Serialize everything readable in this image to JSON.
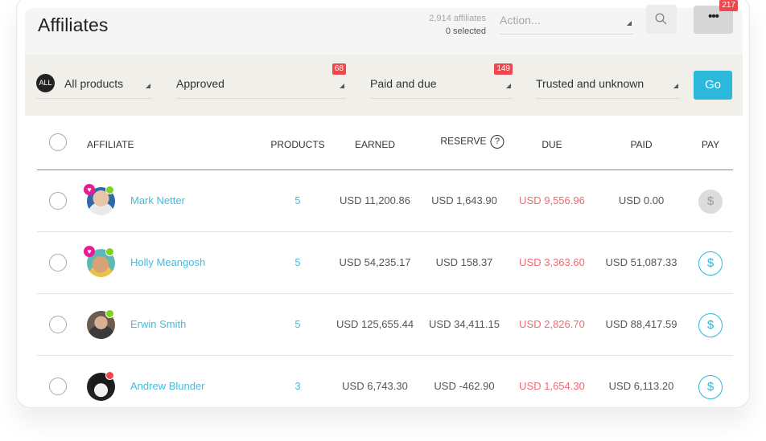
{
  "header": {
    "title": "Affiliates",
    "total_count": "2,914 affiliates",
    "selected_count": "0 selected",
    "action_placeholder": "Action...",
    "search_icon": "search-icon",
    "more_icon": "ellipsis-icon",
    "more_badge": "217"
  },
  "filters": {
    "products": {
      "icon_label": "ALL",
      "label": "All products"
    },
    "approval": {
      "label": "Approved",
      "badge": "68"
    },
    "payment": {
      "label": "Paid and due",
      "badge": "149"
    },
    "trust": {
      "label": "Trusted and unknown"
    },
    "go_label": "Go"
  },
  "table": {
    "columns": {
      "affiliate": "AFFILIATE",
      "products": "PRODUCTS",
      "earned": "EARNED",
      "reserve": "RESERVE",
      "reserve_help": "?",
      "due": "DUE",
      "paid": "PAID",
      "pay": "PAY"
    },
    "rows": [
      {
        "name": "Mark Netter",
        "products": "5",
        "earned": "USD 11,200.86",
        "reserve": "USD 1,643.90",
        "due": "USD 9,556.96",
        "paid": "USD 0.00",
        "pay_icon": "$",
        "pay_enabled": false,
        "favorite": true,
        "status": "online",
        "status_color": "#7ed321"
      },
      {
        "name": "Holly Meangosh",
        "products": "5",
        "earned": "USD 54,235.17",
        "reserve": "USD 158.37",
        "due": "USD 3,363.60",
        "paid": "USD 51,087.33",
        "pay_icon": "$",
        "pay_enabled": true,
        "favorite": true,
        "status": "online",
        "status_color": "#7ed321"
      },
      {
        "name": "Erwin Smith",
        "products": "5",
        "earned": "USD 125,655.44",
        "reserve": "USD 34,411.15",
        "due": "USD 2,826.70",
        "paid": "USD 88,417.59",
        "pay_icon": "$",
        "pay_enabled": true,
        "favorite": false,
        "status": "online",
        "status_color": "#7ed321"
      },
      {
        "name": "Andrew Blunder",
        "products": "3",
        "earned": "USD 6,743.30",
        "reserve": "USD -462.90",
        "due": "USD 1,654.30",
        "paid": "USD 6,113.20",
        "pay_icon": "$",
        "pay_enabled": true,
        "favorite": false,
        "status": "blocked",
        "status_color": "#f0474f"
      }
    ]
  },
  "colors": {
    "accent": "#2bb8db",
    "link": "#45bcd8",
    "due": "#ee6b73",
    "badge": "#f0474f",
    "favorite": "#ea1a93"
  }
}
